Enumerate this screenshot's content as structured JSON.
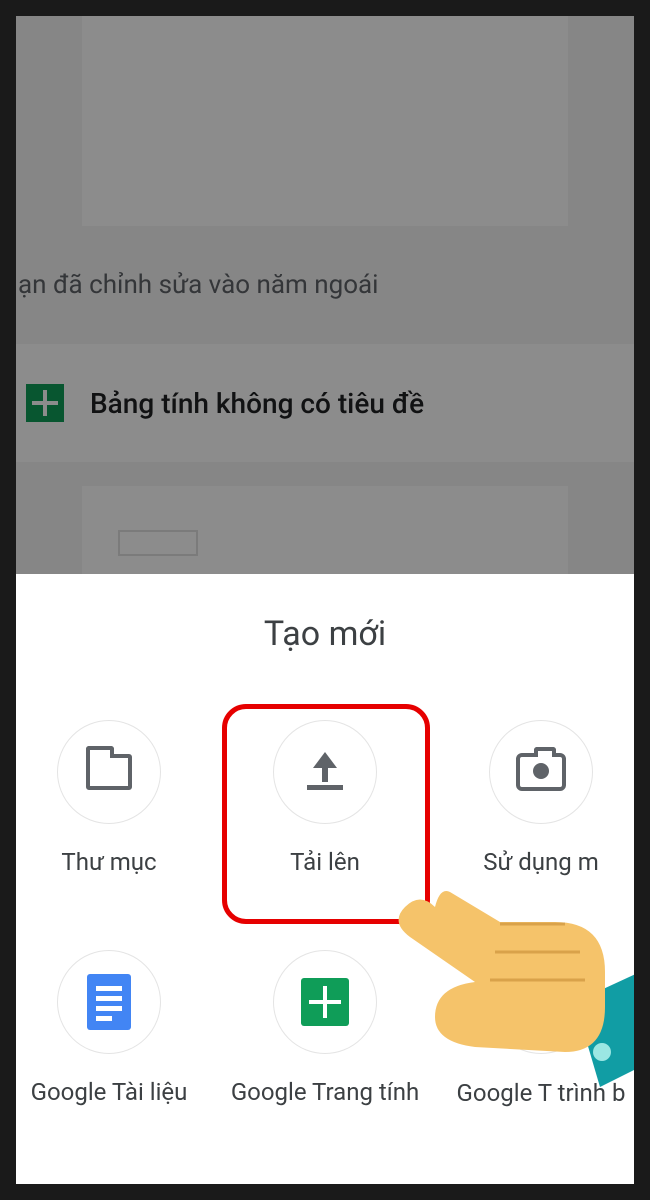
{
  "background": {
    "section_header": "ạn đã chỉnh sửa vào năm ngoái",
    "untitled_sheet": "Bảng tính không có tiêu đề"
  },
  "sheet": {
    "title": "Tạo mới",
    "items": {
      "folder": {
        "label": "Thư mục"
      },
      "upload": {
        "label": "Tải lên"
      },
      "camera": {
        "label": "Sử dụng m"
      },
      "docs": {
        "label": "Google Tài liệu"
      },
      "sheets": {
        "label": "Google Trang tính"
      },
      "slides": {
        "label": "Google T\ntrình b"
      }
    }
  }
}
